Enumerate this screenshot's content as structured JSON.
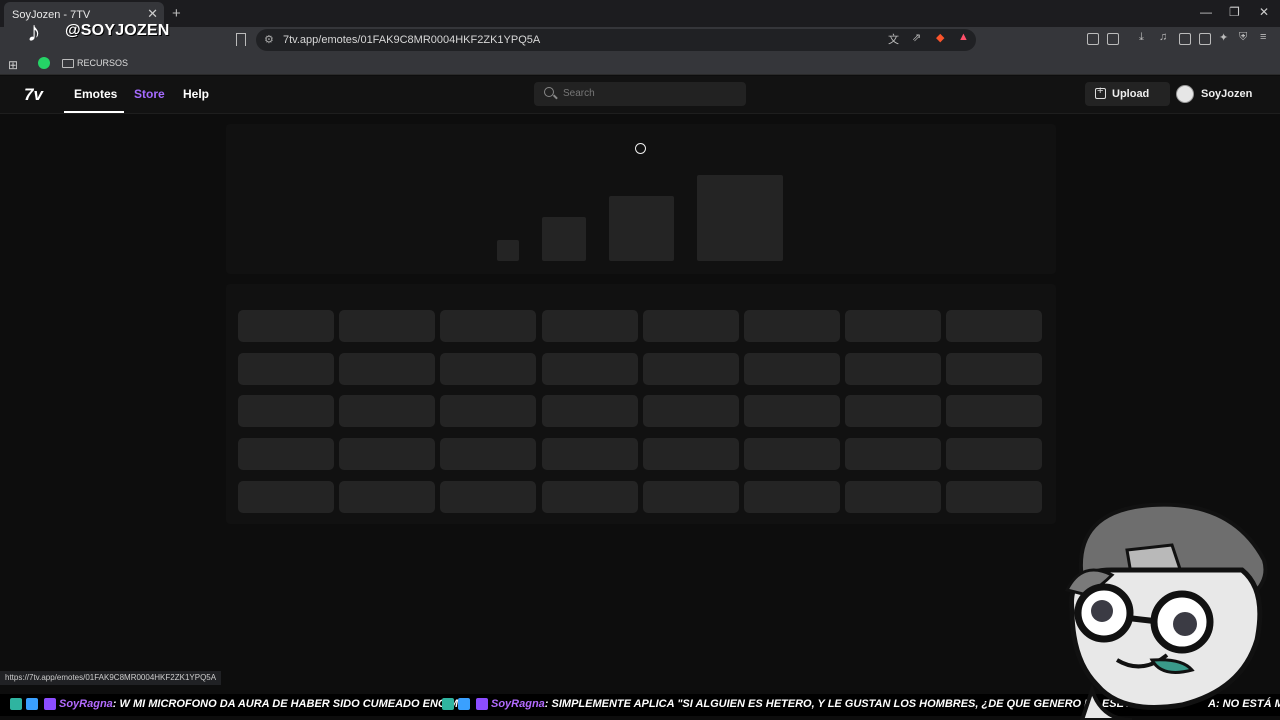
{
  "browser": {
    "tab_title": "SoyJozen - 7TV",
    "url": "7tv.app/emotes/01FAK9C8MR0004HKF2ZK1YPQ5A",
    "bookmark_folder": "RECURSOS",
    "status_url": "https://7tv.app/emotes/01FAK9C8MR0004HKF2ZK1YPQ5A"
  },
  "overlay": {
    "tiktok_handle": "@SOYJOZEN"
  },
  "nav": {
    "logo": "7v",
    "emotes": "Emotes",
    "store": "Store",
    "help": "Help",
    "search_placeholder": "Search",
    "upload": "Upload",
    "username": "SoyJozen"
  },
  "chat": {
    "msg1_user": "SoyRagna",
    "msg1_text": ": W MI MICROFONO DA AURA DE HABER SIDO CUMEADO ENCIMA",
    "msg2_user": "SoyRagna",
    "msg2_text": ": SIMPLEMENTE APLICA \"SI ALGUIEN ES HETERO, Y LE GUSTAN LOS HOMBRES, ¿DE QUE GENERO ES ESE ALGUIEN",
    "msg3_text": "A: NO ESTÁ MA"
  },
  "colors": {
    "accent": "#a56bff",
    "chat_user": "#b36bff"
  }
}
